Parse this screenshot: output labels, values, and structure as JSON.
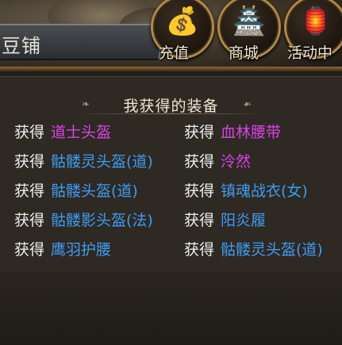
{
  "shop": {
    "title": "豆铺"
  },
  "nav": [
    {
      "label": "充值",
      "icon": "gold-ingot-icon",
      "glyph": "💰"
    },
    {
      "label": "商城",
      "icon": "palace-icon",
      "glyph": "🏯"
    },
    {
      "label": "活动中",
      "icon": "event-icon",
      "glyph": "🏮"
    }
  ],
  "panel": {
    "title": "我获得的装备",
    "gain_label": "获得",
    "left_items": [
      {
        "name": "道士头盔",
        "color": "#d944e6"
      },
      {
        "name": "骷髅灵头盔(道)",
        "color": "#3d9cf2"
      },
      {
        "name": "骷髅头盔(道)",
        "color": "#3d9cf2"
      },
      {
        "name": "骷髅影头盔(法)",
        "color": "#3d9cf2"
      },
      {
        "name": "鹰羽护腰",
        "color": "#3d9cf2"
      }
    ],
    "right_items": [
      {
        "name": "血林腰带",
        "color": "#d944e6"
      },
      {
        "name": "泠然",
        "color": "#d944e6"
      },
      {
        "name": "镇魂战衣(女)",
        "color": "#3d9cf2"
      },
      {
        "name": "阳炎履",
        "color": "#3d9cf2"
      },
      {
        "name": "骷髅灵头盔(道)",
        "color": "#3d9cf2"
      }
    ]
  }
}
